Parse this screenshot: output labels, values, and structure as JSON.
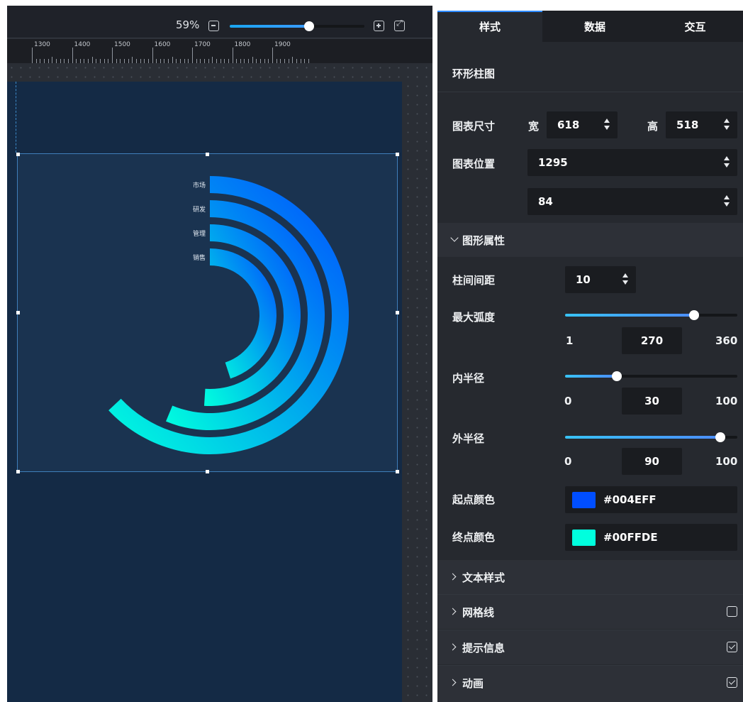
{
  "zoom": {
    "label": "59%",
    "value": 0.59
  },
  "ruler": {
    "ticks": [
      "1300",
      "1400",
      "1500",
      "1600",
      "1700",
      "1800",
      "1900"
    ]
  },
  "chart_data": {
    "type": "radial-bar",
    "categories": [
      "市场",
      "研发",
      "管理",
      "销售"
    ],
    "values": [
      84,
      75,
      68,
      60
    ],
    "max_angle": 270,
    "gradient": {
      "start": "#004EFF",
      "end": "#00FFDE"
    }
  },
  "panel": {
    "tabs": [
      "样式",
      "数据",
      "交互"
    ],
    "active_tab": "样式",
    "component_title": "环形柱图",
    "size": {
      "label": "图表尺寸",
      "width_label": "宽",
      "width": "618",
      "height_label": "高",
      "height": "518"
    },
    "position": {
      "label": "图表位置",
      "x": "1295",
      "y": "84"
    },
    "shape_group": {
      "label": "图形属性",
      "expanded": true
    },
    "bar_gap": {
      "label": "柱间间距",
      "value": "10"
    },
    "max_arc": {
      "label": "最大弧度",
      "min": "1",
      "max": "360",
      "value": "270",
      "fraction": 0.748
    },
    "inner_radius": {
      "label": "内半径",
      "min": "0",
      "max": "100",
      "value": "30",
      "fraction": 0.3
    },
    "outer_radius": {
      "label": "外半径",
      "min": "0",
      "max": "100",
      "value": "90",
      "fraction": 0.9
    },
    "start_color": {
      "label": "起点颜色",
      "value": "#004EFF"
    },
    "end_color": {
      "label": "终点颜色",
      "value": "#00FFDE"
    },
    "groups": [
      {
        "label": "文本样式",
        "has_checkbox": false,
        "checked": false
      },
      {
        "label": "网格线",
        "has_checkbox": true,
        "checked": false
      },
      {
        "label": "提示信息",
        "has_checkbox": true,
        "checked": true
      },
      {
        "label": "动画",
        "has_checkbox": true,
        "checked": true
      }
    ]
  }
}
